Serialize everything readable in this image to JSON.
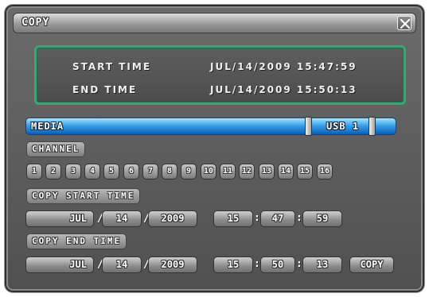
{
  "window": {
    "title": "COPY",
    "close_icon": "close-x-icon"
  },
  "summary": {
    "start_label": "START TIME",
    "start_value": "JUL/14/2009 15:47:59",
    "end_label": "END TIME",
    "end_value": "JUL/14/2009 15:50:13"
  },
  "media": {
    "label": "MEDIA",
    "value": "USB 1"
  },
  "channel": {
    "label": "CHANNEL",
    "items": [
      "1",
      "2",
      "3",
      "4",
      "5",
      "6",
      "7",
      "8",
      "9",
      "10",
      "11",
      "12",
      "13",
      "14",
      "15",
      "16"
    ]
  },
  "copy_start": {
    "label": "COPY START TIME",
    "month": "JUL",
    "day": "14",
    "year": "2009",
    "hour": "15",
    "minute": "47",
    "second": "59"
  },
  "copy_end": {
    "label": "COPY END TIME",
    "month": "JUL",
    "day": "14",
    "year": "2009",
    "hour": "15",
    "minute": "50",
    "second": "13"
  },
  "separators": {
    "date": "/",
    "time": ":"
  },
  "buttons": {
    "copy": "COPY"
  },
  "colors": {
    "panel_border": "#35a878",
    "media_bar": "#3aa0e8"
  }
}
